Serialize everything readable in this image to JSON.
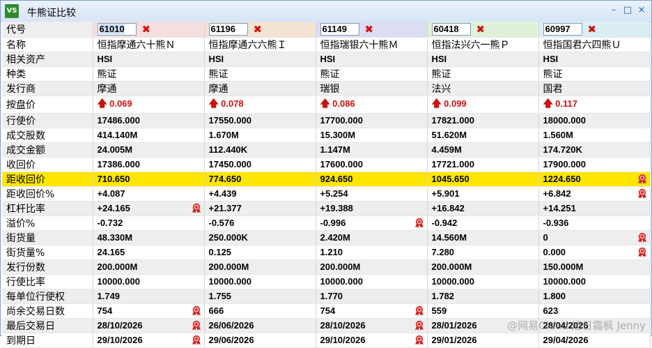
{
  "window": {
    "title": "牛熊证比较",
    "icon_text": "VS",
    "controls": [
      "–",
      "□",
      "×"
    ]
  },
  "columns": [
    {
      "code": "61010",
      "name": "恒指摩通六十熊Ｎ",
      "color": "#f6dede"
    },
    {
      "code": "61196",
      "name": "恒指摩通六六熊Ｉ",
      "color": "#f4e3d3"
    },
    {
      "code": "61149",
      "name": "恒指瑞银六十熊Ｍ",
      "color": "#dcdcf2"
    },
    {
      "code": "60418",
      "name": "恒指法兴六一熊Ｐ",
      "color": "#dff1d8"
    },
    {
      "code": "60997",
      "name": "恒指国君六四熊Ｕ",
      "color": "#dbeef4"
    }
  ],
  "rows": [
    {
      "label": "名称",
      "key": "name",
      "style": "white",
      "kind": "txt",
      "values": [
        "恒指摩通六十熊Ｎ",
        "恒指摩通六六熊Ｉ",
        "恒指瑞银六十熊Ｍ",
        "恒指法兴六一熊Ｐ",
        "恒指国君六四熊Ｕ"
      ],
      "medal": [
        false,
        false,
        false,
        false,
        false
      ]
    },
    {
      "label": "相关资产",
      "style": "alt",
      "kind": "val",
      "values": [
        "HSI",
        "HSI",
        "HSI",
        "HSI",
        "HSI"
      ],
      "medal": [
        false,
        false,
        false,
        false,
        false
      ]
    },
    {
      "label": "种类",
      "style": "white",
      "kind": "txt",
      "values": [
        "熊证",
        "熊证",
        "熊证",
        "熊证",
        "熊证"
      ],
      "medal": [
        false,
        false,
        false,
        false,
        false
      ]
    },
    {
      "label": "发行商",
      "style": "alt",
      "kind": "txt",
      "values": [
        "摩通",
        "摩通",
        "瑞银",
        "法兴",
        "国君"
      ],
      "medal": [
        false,
        false,
        false,
        false,
        false
      ]
    },
    {
      "label": "按盘价",
      "style": "white",
      "kind": "price",
      "values": [
        "0.069",
        "0.078",
        "0.086",
        "0.099",
        "0.117"
      ],
      "medal": [
        false,
        false,
        false,
        false,
        false
      ]
    },
    {
      "label": "行使价",
      "style": "alt",
      "kind": "val",
      "values": [
        "17486.000",
        "17550.000",
        "17700.000",
        "17821.000",
        "18000.000"
      ],
      "medal": [
        false,
        false,
        false,
        false,
        false
      ]
    },
    {
      "label": "成交股数",
      "style": "white",
      "kind": "val",
      "values": [
        "414.140M",
        "1.670M",
        "15.300M",
        "51.620M",
        "1.560M"
      ],
      "medal": [
        false,
        false,
        false,
        false,
        false
      ]
    },
    {
      "label": "成交金额",
      "style": "alt",
      "kind": "val",
      "values": [
        "24.005M",
        "112.440K",
        "1.147M",
        "4.459M",
        "174.720K"
      ],
      "medal": [
        false,
        false,
        false,
        false,
        false
      ]
    },
    {
      "label": "收回价",
      "style": "white",
      "kind": "val",
      "values": [
        "17386.000",
        "17450.000",
        "17600.000",
        "17721.000",
        "17900.000"
      ],
      "medal": [
        false,
        false,
        false,
        false,
        false
      ]
    },
    {
      "label": "距收回价",
      "style": "hl",
      "kind": "val",
      "values": [
        "710.650",
        "774.650",
        "924.650",
        "1045.650",
        "1224.650"
      ],
      "medal": [
        false,
        false,
        false,
        false,
        true
      ]
    },
    {
      "label": "距收回价%",
      "style": "white",
      "kind": "val",
      "values": [
        "+4.087",
        "+4.439",
        "+5.254",
        "+5.901",
        "+6.842"
      ],
      "medal": [
        false,
        false,
        false,
        false,
        true
      ]
    },
    {
      "label": "杠杆比率",
      "style": "alt",
      "kind": "val",
      "values": [
        "+24.165",
        "+21.377",
        "+19.388",
        "+16.842",
        "+14.251"
      ],
      "medal": [
        true,
        false,
        false,
        false,
        false
      ]
    },
    {
      "label": "溢价%",
      "style": "white",
      "kind": "val",
      "values": [
        "-0.732",
        "-0.576",
        "-0.996",
        "-0.942",
        "-0.936"
      ],
      "medal": [
        false,
        false,
        true,
        false,
        false
      ]
    },
    {
      "label": "街货量",
      "style": "alt",
      "kind": "val",
      "values": [
        "48.330M",
        "250.000K",
        "2.420M",
        "14.560M",
        "0"
      ],
      "medal": [
        false,
        false,
        false,
        false,
        true
      ]
    },
    {
      "label": "街货量%",
      "style": "white",
      "kind": "val",
      "values": [
        "24.165",
        "0.125",
        "1.210",
        "7.280",
        "0.000"
      ],
      "medal": [
        false,
        false,
        false,
        false,
        true
      ]
    },
    {
      "label": "发行份数",
      "style": "alt",
      "kind": "val",
      "values": [
        "200.000M",
        "200.000M",
        "200.000M",
        "200.000M",
        "150.000M"
      ],
      "medal": [
        false,
        false,
        false,
        false,
        false
      ]
    },
    {
      "label": "行使比率",
      "style": "white",
      "kind": "val",
      "values": [
        "10000.000",
        "10000.000",
        "10000.000",
        "10000.000",
        "10000.000"
      ],
      "medal": [
        false,
        false,
        false,
        false,
        false
      ]
    },
    {
      "label": "每单位行使权",
      "style": "alt",
      "kind": "val",
      "values": [
        "1.749",
        "1.755",
        "1.770",
        "1.782",
        "1.800"
      ],
      "medal": [
        false,
        false,
        false,
        false,
        false
      ]
    },
    {
      "label": "尚余交易日数",
      "style": "white",
      "kind": "val",
      "values": [
        "754",
        "666",
        "754",
        "559",
        "623"
      ],
      "medal": [
        true,
        false,
        true,
        false,
        false
      ]
    },
    {
      "label": "最后交易日",
      "style": "alt",
      "kind": "val",
      "values": [
        "28/10/2026",
        "26/06/2026",
        "28/10/2026",
        "28/01/2026",
        "28/04/2026"
      ],
      "medal": [
        true,
        false,
        true,
        false,
        false
      ]
    },
    {
      "label": "到期日",
      "style": "white",
      "kind": "val",
      "values": [
        "29/10/2026",
        "29/06/2026",
        "29/10/2026",
        "29/01/2026",
        "29/04/2026"
      ],
      "medal": [
        true,
        false,
        true,
        false,
        false
      ]
    }
  ],
  "header_label": "代号",
  "remove_symbol": "✖",
  "price_arrow": "🡅",
  "watermark": "@网易Cloud 旭日霜枫 Jenny"
}
